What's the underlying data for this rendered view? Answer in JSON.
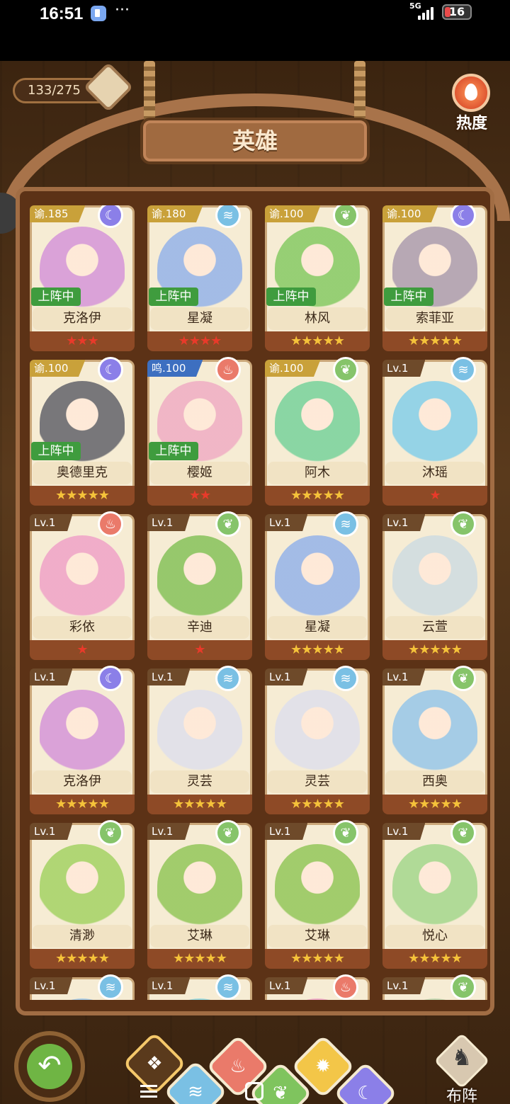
{
  "status_bar": {
    "time": "16:51",
    "more": "···",
    "network": "5G",
    "battery": "16"
  },
  "header": {
    "count": "133/275",
    "title": "英雄",
    "hot_label": "热度"
  },
  "heroes": [
    {
      "name": "克洛伊",
      "level": "谕.185",
      "element": "moon",
      "deployed": true,
      "stars": 3,
      "star_color": "red",
      "badge": "gold",
      "art": "#d79ad8"
    },
    {
      "name": "星凝",
      "level": "谕.180",
      "element": "wind",
      "deployed": true,
      "stars": 4,
      "star_color": "red",
      "badge": "gold",
      "art": "#9ab6e8"
    },
    {
      "name": "林风",
      "level": "谕.100",
      "element": "leaf",
      "deployed": true,
      "stars": 5,
      "star_color": "gold",
      "badge": "gold",
      "art": "#8ccc6a"
    },
    {
      "name": "索菲亚",
      "level": "谕.100",
      "element": "moon",
      "deployed": true,
      "stars": 5,
      "star_color": "gold",
      "badge": "gold",
      "art": "#b0a0b0"
    },
    {
      "name": "奥德里克",
      "level": "谕.100",
      "element": "moon",
      "deployed": true,
      "stars": 5,
      "star_color": "gold",
      "badge": "gold",
      "art": "#6a6a70"
    },
    {
      "name": "樱姬",
      "level": "鸣.100",
      "element": "fire",
      "deployed": true,
      "stars": 2,
      "star_color": "red",
      "badge": "blue",
      "art": "#f0b0c4"
    },
    {
      "name": "阿木",
      "level": "谕.100",
      "element": "leaf",
      "deployed": false,
      "stars": 5,
      "star_color": "gold",
      "badge": "gold",
      "art": "#7ed49e"
    },
    {
      "name": "沐瑶",
      "level": "Lv.1",
      "element": "wind",
      "deployed": false,
      "stars": 1,
      "star_color": "red",
      "badge": "brown",
      "art": "#8ad0e8"
    },
    {
      "name": "彩依",
      "level": "Lv.1",
      "element": "fire",
      "deployed": false,
      "stars": 1,
      "star_color": "red",
      "badge": "brown",
      "art": "#f0a6c8"
    },
    {
      "name": "辛迪",
      "level": "Lv.1",
      "element": "leaf",
      "deployed": false,
      "stars": 1,
      "star_color": "red",
      "badge": "brown",
      "art": "#8cc460"
    },
    {
      "name": "星凝",
      "level": "Lv.1",
      "element": "wind",
      "deployed": false,
      "stars": 5,
      "star_color": "gold",
      "badge": "brown",
      "art": "#9ab6e8"
    },
    {
      "name": "云萱",
      "level": "Lv.1",
      "element": "leaf",
      "deployed": false,
      "stars": 5,
      "star_color": "gold",
      "badge": "brown",
      "art": "#d0dce0"
    },
    {
      "name": "克洛伊",
      "level": "Lv.1",
      "element": "moon",
      "deployed": false,
      "stars": 5,
      "star_color": "gold",
      "badge": "brown",
      "art": "#d79ad8"
    },
    {
      "name": "灵芸",
      "level": "Lv.1",
      "element": "wind",
      "deployed": false,
      "stars": 5,
      "star_color": "gold",
      "badge": "brown",
      "art": "#e0e0ea"
    },
    {
      "name": "灵芸",
      "level": "Lv.1",
      "element": "wind",
      "deployed": false,
      "stars": 5,
      "star_color": "gold",
      "badge": "brown",
      "art": "#e0e0ea"
    },
    {
      "name": "西奥",
      "level": "Lv.1",
      "element": "leaf",
      "deployed": false,
      "stars": 5,
      "star_color": "gold",
      "badge": "brown",
      "art": "#9cc8e8"
    },
    {
      "name": "清渺",
      "level": "Lv.1",
      "element": "leaf",
      "deployed": false,
      "stars": 5,
      "star_color": "gold",
      "badge": "brown",
      "art": "#a8d46a"
    },
    {
      "name": "艾琳",
      "level": "Lv.1",
      "element": "leaf",
      "deployed": false,
      "stars": 5,
      "star_color": "gold",
      "badge": "brown",
      "art": "#98c860"
    },
    {
      "name": "艾琳",
      "level": "Lv.1",
      "element": "leaf",
      "deployed": false,
      "stars": 5,
      "star_color": "gold",
      "badge": "brown",
      "art": "#98c860"
    },
    {
      "name": "悦心",
      "level": "Lv.1",
      "element": "leaf",
      "deployed": false,
      "stars": 5,
      "star_color": "gold",
      "badge": "brown",
      "art": "#a8d890"
    },
    {
      "name": "",
      "level": "Lv.1",
      "element": "wind",
      "deployed": false,
      "stars": 0,
      "star_color": "gold",
      "badge": "brown",
      "art": "#a0c8e8"
    },
    {
      "name": "",
      "level": "Lv.1",
      "element": "wind",
      "deployed": false,
      "stars": 0,
      "star_color": "gold",
      "badge": "brown",
      "art": "#90d8e0"
    },
    {
      "name": "",
      "level": "Lv.1",
      "element": "fire",
      "deployed": false,
      "stars": 0,
      "star_color": "gold",
      "badge": "brown",
      "art": "#f0a6c8"
    },
    {
      "name": "",
      "level": "Lv.1",
      "element": "leaf",
      "deployed": false,
      "stars": 0,
      "star_color": "gold",
      "badge": "brown",
      "art": "#c0d8b0"
    }
  ],
  "deployed_label": "上阵中",
  "element_glyphs": {
    "moon": "☾",
    "leaf": "❦",
    "wind": "≋",
    "fire": "♨"
  },
  "footer": {
    "formation_label": "布阵",
    "formation_icon": "♞",
    "back_icon": "↶",
    "filters": {
      "all": "❖",
      "wind": "≋",
      "fire": "♨",
      "leaf": "❦",
      "light": "✹",
      "moon": "☾"
    }
  },
  "colors": {
    "badge_gold": "#c9a13a",
    "badge_blue": "#3d6fc0",
    "badge_brown": "#6e4a2a"
  }
}
